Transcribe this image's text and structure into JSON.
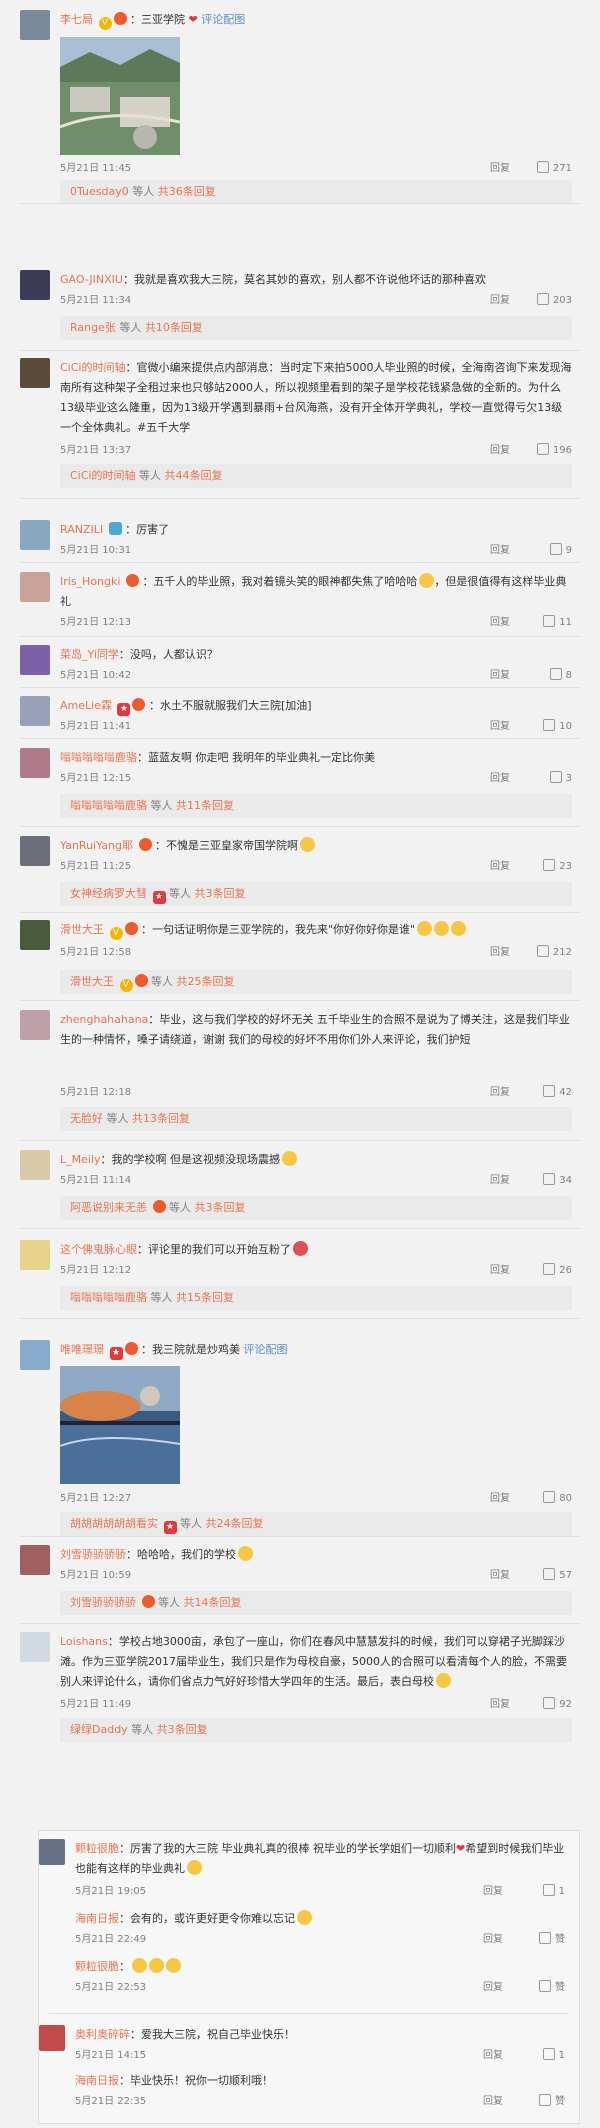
{
  "comments": [
    {
      "user": "李七局",
      "text": "三亚学院",
      "link": "评论配图",
      "date": "5月21日 11:45",
      "reply": "回复",
      "likes": "271",
      "sub_user": "0Tuesday0",
      "sub_rest": "等人",
      "sub_count": "共36条回复"
    },
    {
      "user": "GAO-JINXIU",
      "text": "我就是喜欢我大三院，莫名其妙的喜欢，别人都不许说他坏话的那种喜欢",
      "date": "5月21日 11:34",
      "reply": "回复",
      "likes": "203",
      "sub_user": "Range张",
      "sub_rest": "等人",
      "sub_count": "共10条回复"
    },
    {
      "user": "CiCi的时间轴",
      "text": "官微小编来提供点内部消息：当时定下来拍5000人毕业照的时候，全海南咨询下来发现海南所有这种架子全租过来也只够站2000人，所以视频里看到的架子是学校花钱紧急做的全新的。为什么13级毕业这么隆重，因为13级开学遇到暴雨+台风海燕，没有开全体开学典礼，学校一直觉得亏欠13级一个全体典礼。#五千大学",
      "date": "5月21日 13:37",
      "reply": "回复",
      "likes": "196",
      "sub_user": "CiCi的时间轴",
      "sub_rest": "等人",
      "sub_count": "共44条回复"
    },
    {
      "user": "RANZILI",
      "text": "厉害了",
      "date": "5月21日 10:31",
      "reply": "回复",
      "likes": "9"
    },
    {
      "user": "Iris_Hongki",
      "text": "五千人的毕业照，我对着镜头笑的眼神都失焦了哈哈哈",
      "text2": "，但是很值得有这样毕业典礼",
      "date": "5月21日 12:13",
      "reply": "回复",
      "likes": "11"
    },
    {
      "user": "菜岛_Yi同学",
      "text": "没吗，人都认识？",
      "date": "5月21日 10:42",
      "reply": "回复",
      "likes": "8"
    },
    {
      "user": "AmeLie霖",
      "text": "水土不服就服我们大三院[加油]",
      "date": "5月21日 11:41",
      "reply": "回复",
      "likes": "10"
    },
    {
      "user": "嗡嗡嗡嗡嗡鹿骆",
      "text": "蓝蓝友啊 你走吧 我明年的毕业典礼一定比你美",
      "date": "5月21日 12:15",
      "reply": "回复",
      "likes": "3",
      "sub_user": "嗡嗡嗡嗡嗡鹿骆",
      "sub_rest": "等人",
      "sub_count": "共11条回复"
    },
    {
      "user": "YanRuiYang耶",
      "text": "不愧是三亚皇家帝国学院啊",
      "date": "5月21日 11:25",
      "reply": "回复",
      "likes": "23",
      "sub_user": "女神经病罗大彗",
      "sub_rest": "等人",
      "sub_count": "共3条回复"
    },
    {
      "user": "滑世大王",
      "text": "一句话证明你是三亚学院的，我先来\"你好你好你是谁\"",
      "date": "5月21日 12:58",
      "reply": "回复",
      "likes": "212",
      "sub_user": "滑世大王",
      "sub_rest": "等人",
      "sub_count": "共25条回复"
    },
    {
      "user": "zhenghahahana",
      "text": "毕业，这与我们学校的好坏无关 五千毕业生的合照不是说为了博关注，这是我们毕业生的一种情怀，嗓子请绕道，谢谢",
      "text2": "我们的母校的好坏不用你们外人来评论，我们护短",
      "date": "5月21日 12:18",
      "reply": "回复",
      "likes": "42",
      "sub_user": "无脸好",
      "sub_rest": "等人",
      "sub_count": "共13条回复"
    },
    {
      "user": "L_Meily",
      "text": "我的学校啊  但是这视频没现场震撼",
      "date": "5月21日 11:14",
      "reply": "回复",
      "likes": "34",
      "sub_user": "阿恶说别来无恙",
      "sub_rest": "等人",
      "sub_count": "共3条回复"
    },
    {
      "user": "这个佛鬼脉心眼",
      "text": "评论里的我们可以开始互粉了",
      "date": "5月21日 12:12",
      "reply": "回复",
      "likes": "26",
      "sub_user": "嗡嗡嗡嗡嗡鹿骆",
      "sub_rest": "等人",
      "sub_count": "共15条回复"
    },
    {
      "user": "唯唯璟璟",
      "text": "我三院就是炒鸡美",
      "link": "评论配图",
      "date": "5月21日 12:27",
      "reply": "回复",
      "likes": "80",
      "sub_user": "胡胡胡胡胡胡看实",
      "sub_rest": "等人",
      "sub_count": "共24条回复"
    },
    {
      "user": "刘雪骄骄骄骄",
      "text": "哈哈哈，我们的学校",
      "date": "5月21日 10:59",
      "reply": "回复",
      "likes": "57",
      "sub_user": "刘雪骄骄骄骄",
      "sub_rest": "等人",
      "sub_count": "共14条回复"
    },
    {
      "user": "Loishans",
      "text": "学校占地3000亩，承包了一座山，你们在春风中慧慧发抖的时候，我们可以穿裙子光脚踩沙滩。作为三亚学院2017届毕业生，我们只是作为母校自豪，5000人的合照可以看清每个人的脸，不需要别人来评论什么，请你们省点力气好好珍惜大学四年的生活。最后，表白母校",
      "date": "5月21日 11:49",
      "reply": "回复",
      "likes": "92",
      "sub_user": "绿绿Daddy",
      "sub_rest": "等人",
      "sub_count": "共3条回复"
    }
  ],
  "thread": [
    {
      "user": "颗粒很脆",
      "text": "厉害了我的大三院 毕业典礼真的很棒 祝毕业的学长学姐们一切顺利",
      "text2": "希望到时候我们毕业也能有这样的毕业典礼",
      "date": "5月21日 19:05",
      "reply": "回复",
      "likes": "1"
    },
    {
      "user": "海南日报",
      "text": "会有的，或许更好更令你难以忘记",
      "date": "5月21日 22:49",
      "reply": "回复",
      "likes": "赞"
    },
    {
      "user": "颗粒很脆",
      "text": "",
      "date": "5月21日 22:53",
      "reply": "回复",
      "likes": "赞"
    },
    {
      "user": "奥利奥碎碎",
      "text": "爱我大三院，祝自己毕业快乐！",
      "date": "5月21日 14:15",
      "reply": "回复",
      "likes": "1"
    },
    {
      "user": "海南日报",
      "text": "毕业快乐！祝你一切顺利哦！",
      "date": "5月21日 22:35",
      "reply": "回复",
      "likes": "赞"
    }
  ]
}
